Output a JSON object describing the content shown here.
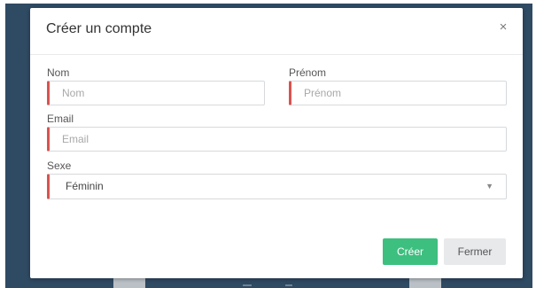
{
  "modal": {
    "title": "Créer un compte",
    "close_icon": "×"
  },
  "form": {
    "nom": {
      "label": "Nom",
      "placeholder": "Nom"
    },
    "prenom": {
      "label": "Prénom",
      "placeholder": "Prénom"
    },
    "email": {
      "label": "Email",
      "placeholder": "Email"
    },
    "sexe": {
      "label": "Sexe",
      "value": "Féminin",
      "caret": "▼"
    }
  },
  "buttons": {
    "create_label": "Créer",
    "close_label": "Fermer"
  },
  "colors": {
    "accent_invalid": "#d9534f",
    "create_button": "#3dbf7f",
    "backdrop": "#2f4a63"
  }
}
